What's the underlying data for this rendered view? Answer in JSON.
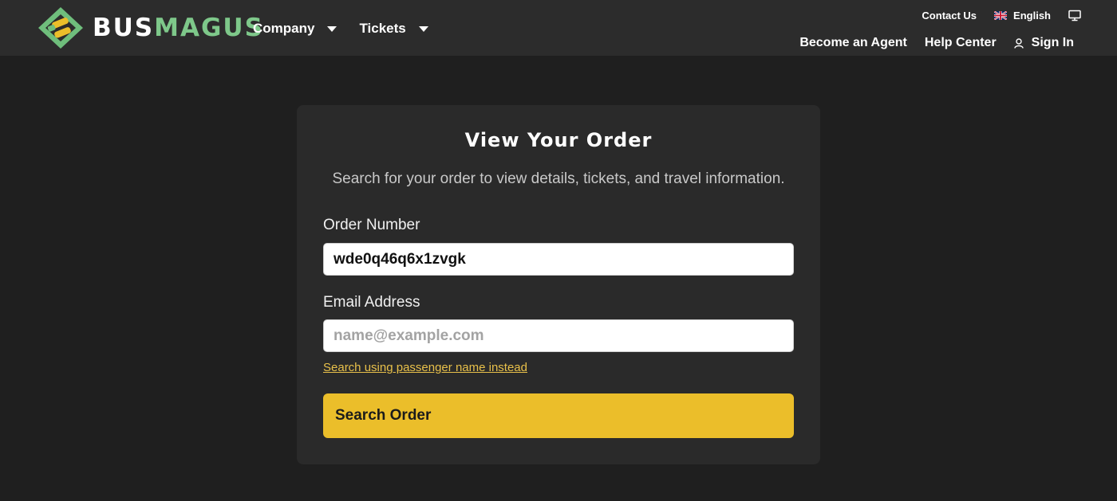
{
  "brand": {
    "logo_text_part1": "BUS",
    "logo_text_part2": "MAGUS",
    "colors": {
      "green": "#7ec88a",
      "yellow": "#ebbe2a"
    }
  },
  "nav": {
    "company": "Company",
    "tickets": "Tickets"
  },
  "utility": {
    "contact": "Contact Us",
    "language": "English",
    "language_icon": "uk-flag-icon",
    "display_icon": "monitor-icon"
  },
  "nav_right": {
    "agent": "Become an Agent",
    "help": "Help Center",
    "signin": "Sign In",
    "signin_icon": "user-icon"
  },
  "card": {
    "title": "View Your Order",
    "subtitle": "Search for your order to view details, tickets, and travel information.",
    "order_label": "Order Number",
    "order_value": "wde0q46q6x1zvgk",
    "email_label": "Email Address",
    "email_placeholder": "name@example.com",
    "alt_link": "Search using passenger name instead",
    "button": "Search Order"
  }
}
